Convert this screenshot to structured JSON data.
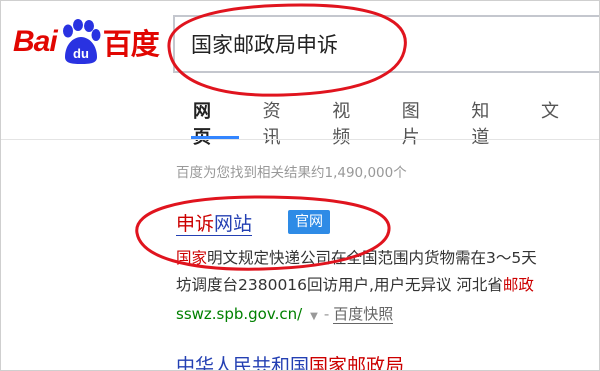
{
  "header": {
    "logo_latin": "Bai",
    "logo_paw_text": "du",
    "logo_chinese": "百度",
    "search_value": "国家邮政局申诉"
  },
  "tabs": [
    {
      "label": "网页",
      "active": true
    },
    {
      "label": "资讯",
      "active": false
    },
    {
      "label": "视频",
      "active": false
    },
    {
      "label": "图片",
      "active": false
    },
    {
      "label": "知道",
      "active": false
    },
    {
      "label": "文",
      "active": false
    }
  ],
  "results": {
    "count_text": "百度为您找到相关结果约1,490,000个",
    "first": {
      "title_highlight": "申诉",
      "title_rest": "网站",
      "badge": "官网",
      "line1_highlight": "国家",
      "line1_rest": "明文规定快递公司在全国范围内货物需在3～5天",
      "line2_text": "坊调度台2380016回访用户,用户无异议 河北省",
      "line2_highlight": "邮政",
      "url": "sswz.spb.gov.cn/",
      "separator": "-",
      "snapshot": "百度快照"
    },
    "second": {
      "title_prefix": "中华人民共和国",
      "title_highlight": "国家邮政局"
    }
  },
  "colors": {
    "brand_red": "#e10601",
    "brand_blue": "#2932e1",
    "link_blue": "#2440b3",
    "highlight_red": "#cc0000",
    "url_green": "#008000",
    "badge_blue": "#2e8be6",
    "annotation_red": "#e0141e"
  },
  "icons": [
    "baidu-paw-logo",
    "dropdown-triangle-icon"
  ]
}
